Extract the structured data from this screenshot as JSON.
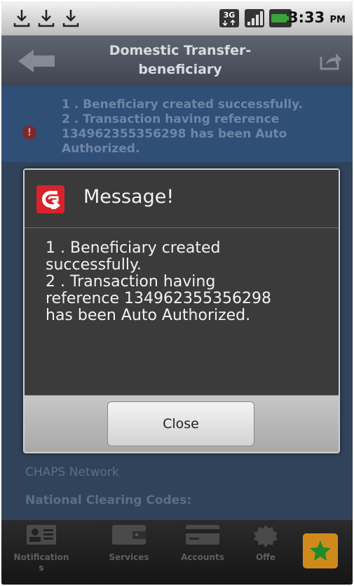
{
  "status_bar": {
    "time": "3:33",
    "ampm": "PM",
    "icons": [
      "download-icon",
      "download-icon",
      "download-icon",
      "3g-icon",
      "signal-icon",
      "battery-icon"
    ]
  },
  "title_bar": {
    "title_line1": "Domestic Transfer-",
    "title_line2": "beneficiary"
  },
  "background": {
    "info_line1": "1 . Beneficiary created successfully.",
    "info_line2": "2 . Transaction having reference",
    "info_line3": "134962355356298 has been Auto",
    "info_line4": "Authorized.",
    "field_chaps": "CHAPS Network",
    "field_clearing": "National Clearing Codes:"
  },
  "dialog": {
    "title": "Message!",
    "line1": "1 . Beneficiary created",
    "line2": "successfully.",
    "line3": "2 . Transaction having",
    "line4": "reference 134962355356298",
    "line5": "has been Auto Authorized.",
    "close_label": "Close"
  },
  "bottom_nav": {
    "items": [
      {
        "label_line1": "Notification",
        "label_line2": "s",
        "icon": "contact-card-icon"
      },
      {
        "label_line1": "Services",
        "label_line2": "",
        "icon": "wallet-icon"
      },
      {
        "label_line1": "Accounts",
        "label_line2": "",
        "icon": "credit-card-icon"
      },
      {
        "label_line1": "Offe",
        "label_line2": "",
        "icon": "badge-icon"
      }
    ],
    "fav_icon": "star-icon"
  },
  "colors": {
    "accent": "#d8232a",
    "favorite": "#d08a1c",
    "star": "#1f8a2a"
  }
}
